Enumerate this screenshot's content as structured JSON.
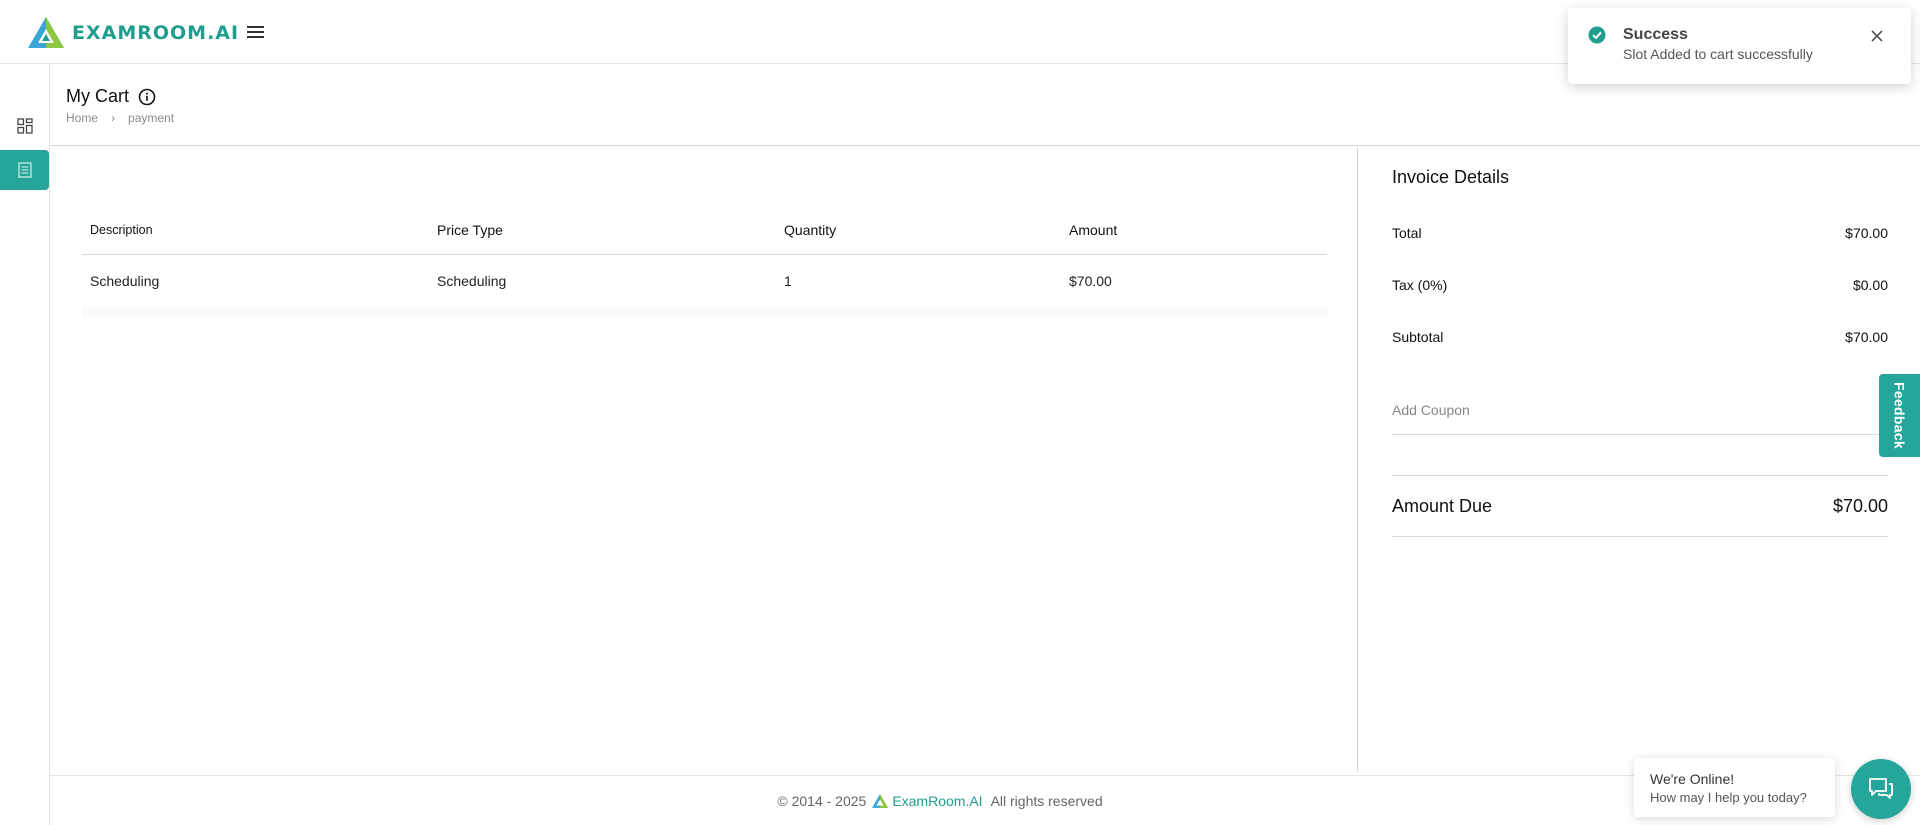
{
  "header": {
    "logo_text": "EXAMROOM.AI"
  },
  "page": {
    "title": "My Cart",
    "breadcrumb": {
      "home": "Home",
      "current": "payment"
    }
  },
  "table": {
    "headers": [
      "Description",
      "Price Type",
      "Quantity",
      "Amount"
    ],
    "rows": [
      {
        "description": "Scheduling",
        "price_type": "Scheduling",
        "quantity": "1",
        "amount": "$70.00"
      }
    ]
  },
  "invoice": {
    "title": "Invoice Details",
    "total_label": "Total",
    "total_value": "$70.00",
    "tax_label": "Tax (0%)",
    "tax_value": "$0.00",
    "subtotal_label": "Subtotal",
    "subtotal_value": "$70.00",
    "coupon_placeholder": "Add Coupon",
    "due_label": "Amount Due",
    "due_value": "$70.00"
  },
  "toast": {
    "title": "Success",
    "message": "Slot Added to cart successfully"
  },
  "feedback_label": "Feedback",
  "chat": {
    "line1": "We're Online!",
    "line2": "How may I help you today?"
  },
  "footer": {
    "copyright": "© 2014 - 2025",
    "brand": "ExamRoom.AI",
    "rights": "All rights reserved"
  },
  "colors": {
    "accent": "#26a69a",
    "brand_text": "#1f9e8f",
    "logo_green": "#8dc63f",
    "logo_blue": "#3aa6d8"
  }
}
